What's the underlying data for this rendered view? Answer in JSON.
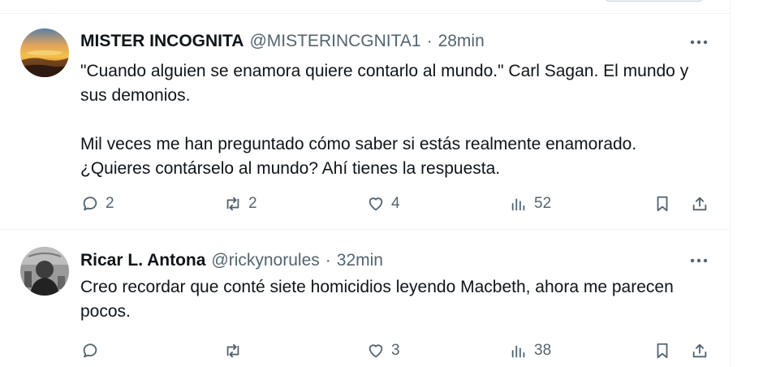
{
  "tweets": [
    {
      "name": "MISTER INCOGNITA",
      "handle": "@MISTERINCGNITA1",
      "separator": "·",
      "time": "28min",
      "paragraphs": [
        "\"Cuando alguien se enamora quiere contarlo al mundo.\" Carl Sagan. El mundo y sus demonios.",
        "Mil veces me han preguntado cómo saber si estás realmente enamorado. ¿Quieres contárselo al mundo? Ahí tienes la respuesta."
      ],
      "replies": "2",
      "reposts": "2",
      "likes": "4",
      "views": "52"
    },
    {
      "name": "Ricar L. Antona",
      "handle": "@rickynorules",
      "separator": "·",
      "time": "32min",
      "paragraphs": [
        "Creo recordar que conté siete homicidios leyendo Macbeth, ahora me parecen pocos."
      ],
      "replies": "",
      "reposts": "",
      "likes": "3",
      "views": "38"
    }
  ],
  "icons": {
    "reply": "reply-icon",
    "repost": "repost-icon",
    "like": "heart-icon",
    "views": "views-icon",
    "bookmark": "bookmark-icon",
    "share": "share-icon",
    "more": "more-icon"
  },
  "colors": {
    "text": "#0f1419",
    "secondary": "#536471",
    "border": "#eff3f4"
  }
}
